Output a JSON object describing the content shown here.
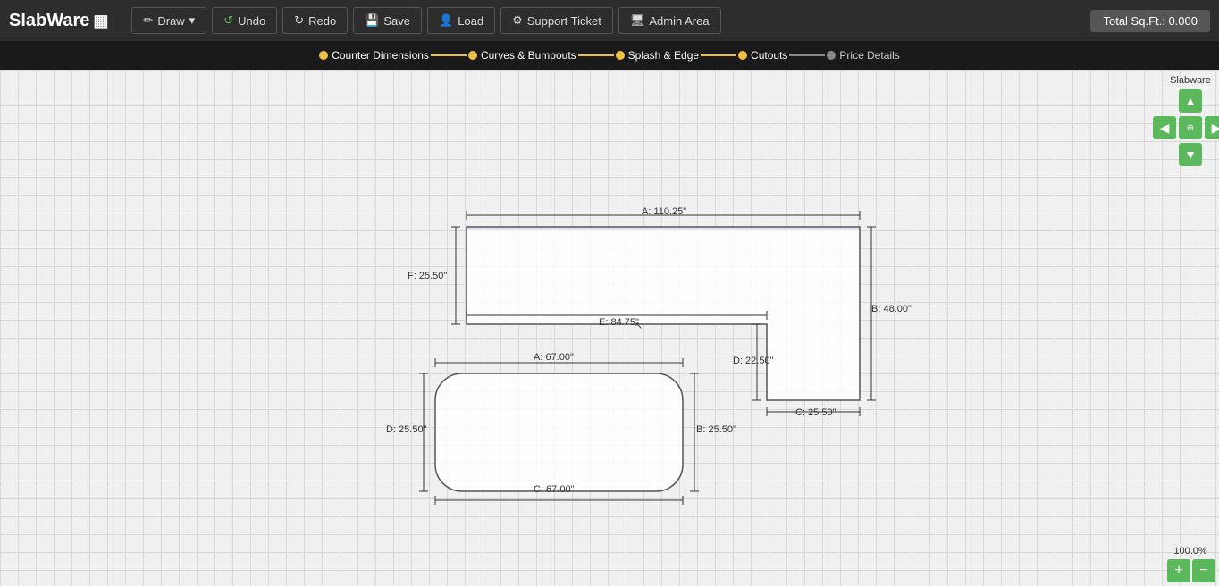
{
  "app": {
    "title": "SlabWare",
    "logo_icon": "▦"
  },
  "navbar": {
    "draw_label": "Draw",
    "undo_label": "Undo",
    "redo_label": "Redo",
    "save_label": "Save",
    "load_label": "Load",
    "support_label": "Support Ticket",
    "admin_label": "Admin Area",
    "total_sqft_label": "Total Sq.Ft.: 0.000"
  },
  "breadcrumb": {
    "steps": [
      {
        "label": "Counter Dimensions",
        "active": true,
        "dot_color": "yellow"
      },
      {
        "label": "Curves & Bumpouts",
        "active": true,
        "dot_color": "yellow"
      },
      {
        "label": "Splash & Edge",
        "active": true,
        "dot_color": "yellow"
      },
      {
        "label": "Cutouts",
        "active": true,
        "dot_color": "yellow"
      },
      {
        "label": "Price Details",
        "active": false,
        "dot_color": "gray"
      }
    ]
  },
  "right_panel": {
    "label": "Slabware",
    "up_arrow": "▲",
    "left_arrow": "◀",
    "center_icon": "⊕",
    "right_arrow": "▶",
    "down_arrow": "▼"
  },
  "zoom": {
    "level": "100.0%",
    "plus_label": "+",
    "minus_label": "−"
  },
  "drawing": {
    "shapes": [
      {
        "id": "upper-counter",
        "type": "L-shape",
        "dims": {
          "A_top": "A: 110.25\"",
          "B_right": "B: 48.00\"",
          "C_bottom_right": "C: 25.50\"",
          "D_notch": "D: 22.50\"",
          "E_step": "E: 84.75\"",
          "F_left": "F: 25.50\""
        }
      },
      {
        "id": "lower-island",
        "type": "rounded-rect",
        "dims": {
          "A_top": "A: 67.00\"",
          "B_right": "B: 25.50\"",
          "C_bottom": "C: 67.00\"",
          "D_left": "D: 25.50\""
        }
      }
    ]
  }
}
